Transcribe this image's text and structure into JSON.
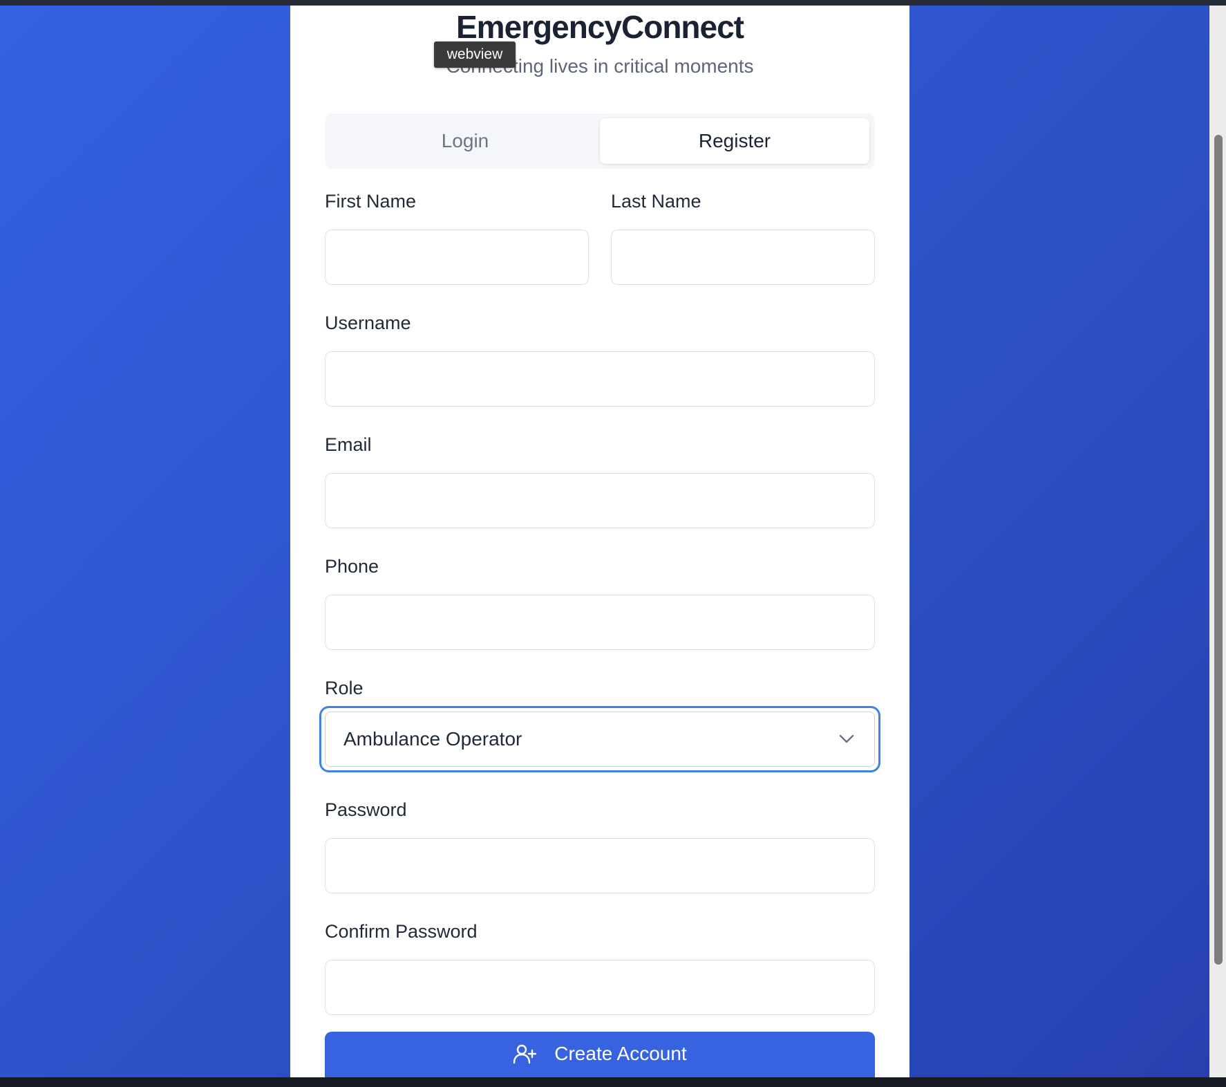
{
  "header": {
    "title": "EmergencyConnect",
    "subtitle": "Connecting lives in critical moments",
    "tooltip": "webview"
  },
  "tabs": [
    {
      "label": "Login",
      "active": false
    },
    {
      "label": "Register",
      "active": true
    }
  ],
  "form": {
    "first_name": {
      "label": "First Name",
      "value": ""
    },
    "last_name": {
      "label": "Last Name",
      "value": ""
    },
    "username": {
      "label": "Username",
      "value": ""
    },
    "email": {
      "label": "Email",
      "value": ""
    },
    "phone": {
      "label": "Phone",
      "value": ""
    },
    "role": {
      "label": "Role",
      "selected": "Ambulance Operator"
    },
    "password": {
      "label": "Password",
      "value": ""
    },
    "confirm_password": {
      "label": "Confirm Password",
      "value": ""
    },
    "submit_label": "Create Account"
  },
  "icons": {
    "role_dropdown": "chevron-down-icon",
    "submit": "user-plus-icon"
  },
  "colors": {
    "background_start": "#3460e2",
    "background_end": "#2740b0",
    "primary_button": "#3763e0",
    "focus_ring": "#3d84e0",
    "title_text": "#1a2233",
    "muted_text": "#5c6677"
  }
}
